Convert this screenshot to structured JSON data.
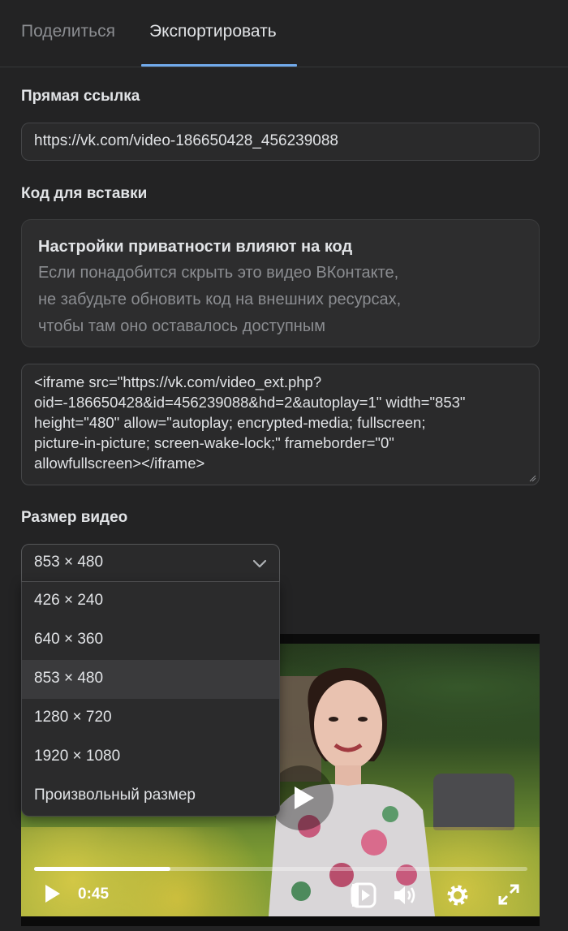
{
  "tabs": [
    {
      "label": "Поделиться",
      "active": false
    },
    {
      "label": "Экспортировать",
      "active": true
    }
  ],
  "direct_link": {
    "label": "Прямая ссылка",
    "value": "https://vk.com/video-186650428_456239088"
  },
  "embed": {
    "label": "Код для вставки",
    "notice_title": "Настройки приватности влияют на код",
    "notice_lines": [
      "Если понадобится скрыть это видео ВКонтакте,",
      "не забудьте обновить код на внешних ресурсах,",
      "чтобы там оно оставалось доступным"
    ],
    "code_lines": [
      "<iframe src=\"https://vk.com/video_ext.php?",
      "oid=-186650428&id=456239088&hd=2&autoplay=1\" width=\"853\"",
      "height=\"480\" allow=\"autoplay; encrypted-media; fullscreen;",
      "picture-in-picture; screen-wake-lock;\" frameborder=\"0\"",
      "allowfullscreen></iframe>"
    ]
  },
  "video_size": {
    "label": "Размер видео",
    "selected": "853 × 480",
    "options": [
      "426 × 240",
      "640 × 360",
      "853 × 480",
      "1280 × 720",
      "1920 × 1080",
      "Произвольный размер"
    ]
  },
  "player": {
    "time": "0:45",
    "progress": 0.276
  },
  "colors": {
    "background": "#232324",
    "accent": "#71aaeb",
    "muted_text": "#8b8d91"
  }
}
